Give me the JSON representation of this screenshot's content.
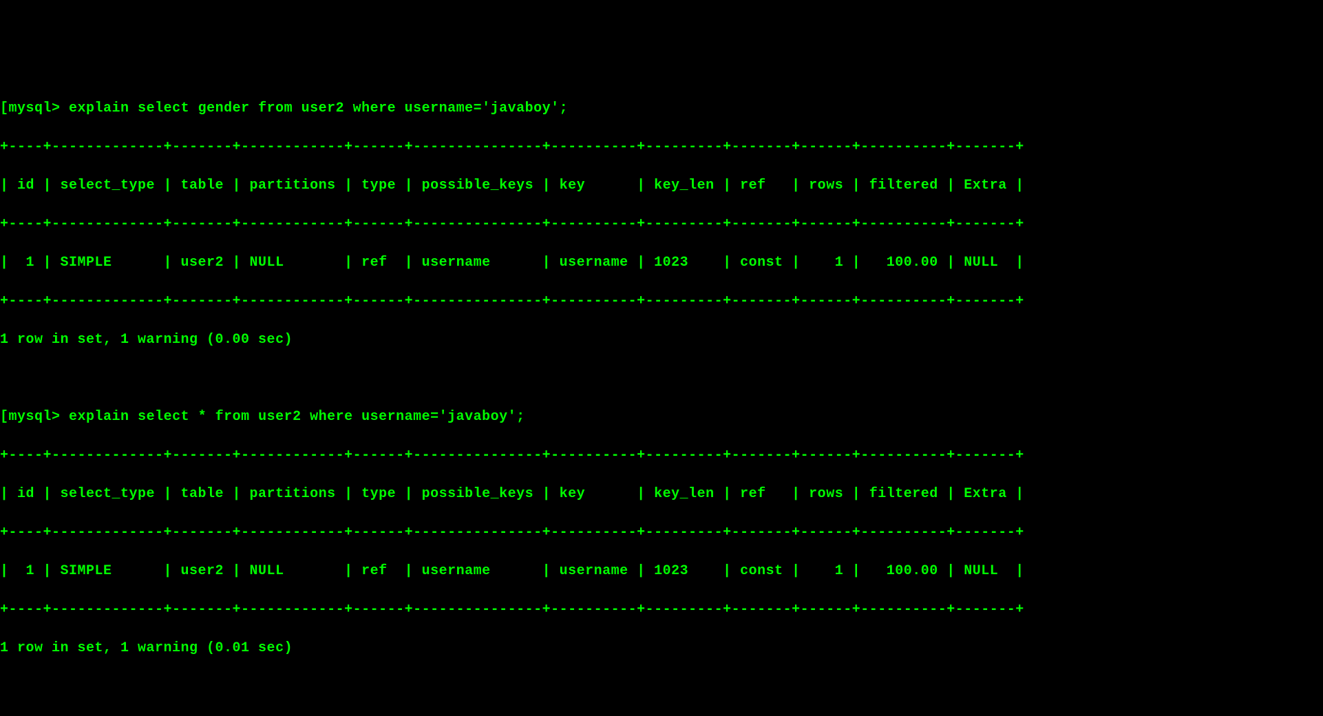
{
  "queries": [
    {
      "prompt": "mysql>",
      "bracket": "[",
      "command": "explain select gender from user2 where username='javaboy';",
      "table": {
        "separator": "+----+-------------+-------+------------+------+---------------+----------+---------+-------+------+----------+-------+",
        "header": "| id | select_type | table | partitions | type | possible_keys | key      | key_len | ref   | rows | filtered | Extra |",
        "row": "|  1 | SIMPLE      | user2 | NULL       | ref  | username      | username | 1023    | const |    1 |   100.00 | NULL  |"
      },
      "status": "1 row in set, 1 warning (0.00 sec)"
    },
    {
      "prompt": "mysql>",
      "bracket": "[",
      "command": "explain select * from user2 where username='javaboy';",
      "table": {
        "separator": "+----+-------------+-------+------------+------+---------------+----------+---------+-------+------+----------+-------+",
        "header": "| id | select_type | table | partitions | type | possible_keys | key      | key_len | ref   | rows | filtered | Extra |",
        "row": "|  1 | SIMPLE      | user2 | NULL       | ref  | username      | username | 1023    | const |    1 |   100.00 | NULL  |"
      },
      "status": "1 row in set, 1 warning (0.01 sec)"
    }
  ],
  "chart_data": {
    "type": "table",
    "tables": [
      {
        "query": "explain select gender from user2 where username='javaboy'",
        "columns": [
          "id",
          "select_type",
          "table",
          "partitions",
          "type",
          "possible_keys",
          "key",
          "key_len",
          "ref",
          "rows",
          "filtered",
          "Extra"
        ],
        "rows": [
          {
            "id": 1,
            "select_type": "SIMPLE",
            "table": "user2",
            "partitions": "NULL",
            "type": "ref",
            "possible_keys": "username",
            "key": "username",
            "key_len": "1023",
            "ref": "const",
            "rows": 1,
            "filtered": "100.00",
            "Extra": "NULL"
          }
        ],
        "status": "1 row in set, 1 warning (0.00 sec)"
      },
      {
        "query": "explain select * from user2 where username='javaboy'",
        "columns": [
          "id",
          "select_type",
          "table",
          "partitions",
          "type",
          "possible_keys",
          "key",
          "key_len",
          "ref",
          "rows",
          "filtered",
          "Extra"
        ],
        "rows": [
          {
            "id": 1,
            "select_type": "SIMPLE",
            "table": "user2",
            "partitions": "NULL",
            "type": "ref",
            "possible_keys": "username",
            "key": "username",
            "key_len": "1023",
            "ref": "const",
            "rows": 1,
            "filtered": "100.00",
            "Extra": "NULL"
          }
        ],
        "status": "1 row in set, 1 warning (0.01 sec)"
      }
    ]
  }
}
